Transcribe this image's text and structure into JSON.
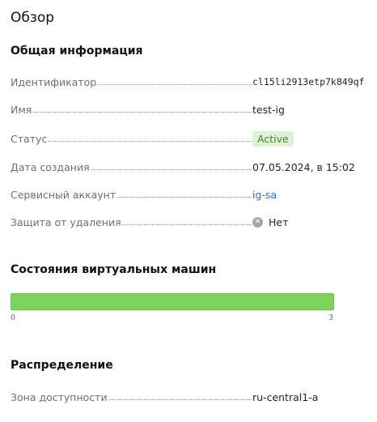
{
  "page": {
    "title": "Обзор"
  },
  "general": {
    "title": "Общая информация",
    "fields": {
      "id": {
        "label": "Идентификатор",
        "value": "cl15li2913etp7k849qf"
      },
      "name": {
        "label": "Имя",
        "value": "test-ig"
      },
      "status": {
        "label": "Статус",
        "value": "Active",
        "color": "#3f8a2d"
      },
      "created": {
        "label": "Дата создания",
        "value": "07.05.2024, в 15:02"
      },
      "service_account": {
        "label": "Сервисный аккаунт",
        "value": "ig-sa"
      },
      "deletion_protection": {
        "label": "Защита от удаления",
        "value": "Нет",
        "icon": "close-circle-icon"
      }
    }
  },
  "vm_states": {
    "title": "Состояния виртуальных машин",
    "min_label": "0",
    "max_label": "3",
    "running_fraction": 1.0,
    "bar_color": "#7ed35d"
  },
  "distribution": {
    "title": "Распределение",
    "zone": {
      "label": "Зона доступности",
      "value": "ru-central1-a"
    }
  }
}
